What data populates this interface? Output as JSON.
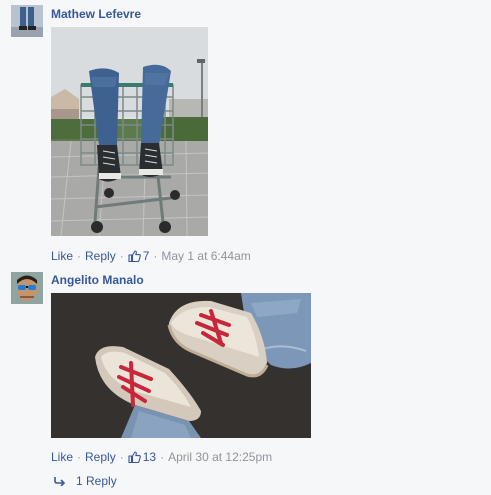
{
  "comments": [
    {
      "author": "Mathew Lefevre",
      "like_label": "Like",
      "reply_label": "Reply",
      "like_count": "7",
      "timestamp": "May 1 at 6:44am",
      "photo_icon": "photo-jeans-shopping-cart"
    },
    {
      "author": "Angelito Manalo",
      "like_label": "Like",
      "reply_label": "Reply",
      "like_count": "13",
      "timestamp": "April 30 at 12:25pm",
      "photo_icon": "photo-red-laced-sneakers",
      "replies_label": "1 Reply"
    }
  ],
  "colors": {
    "link": "#365899",
    "meta": "#90949c",
    "background": "#f6f7f9"
  }
}
